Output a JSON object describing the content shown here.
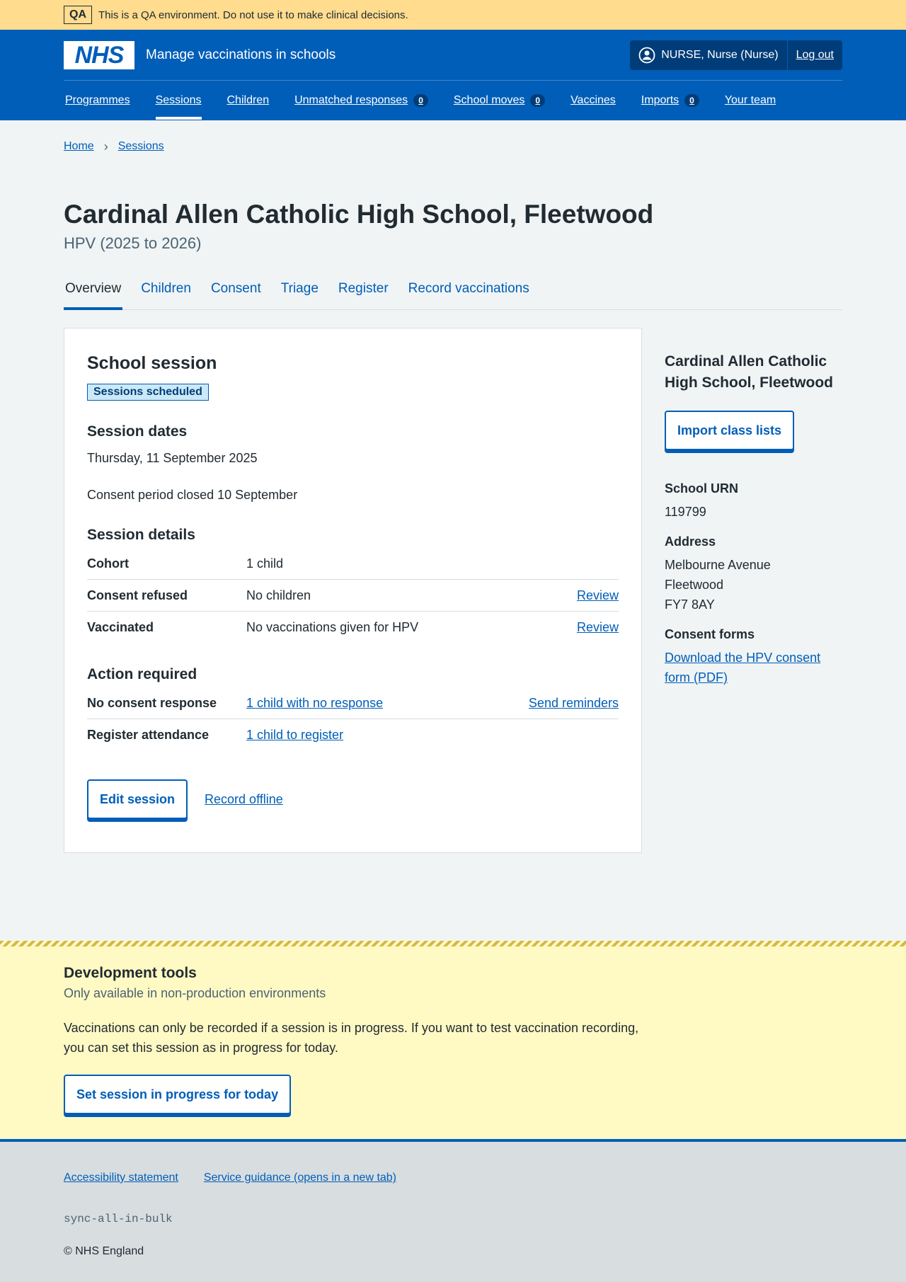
{
  "qa_banner": {
    "tag": "QA",
    "text": "This is a QA environment. Do not use it to make clinical decisions."
  },
  "header": {
    "logo_text": "NHS",
    "service_name": "Manage vaccinations in schools",
    "user_name": "NURSE, Nurse (Nurse)",
    "logout_label": "Log out"
  },
  "nav": {
    "items": [
      {
        "label": "Programmes"
      },
      {
        "label": "Sessions",
        "active": true
      },
      {
        "label": "Children"
      },
      {
        "label": "Unmatched responses",
        "count": "0"
      },
      {
        "label": "School moves",
        "count": "0"
      },
      {
        "label": "Vaccines"
      },
      {
        "label": "Imports",
        "count": "0"
      },
      {
        "label": "Your team"
      }
    ]
  },
  "breadcrumb": {
    "home": "Home",
    "sessions": "Sessions",
    "separator": "›"
  },
  "page": {
    "title": "Cardinal Allen Catholic High School, Fleetwood",
    "subtitle": "HPV (2025 to 2026)"
  },
  "tabs": [
    {
      "label": "Overview",
      "active": true
    },
    {
      "label": "Children"
    },
    {
      "label": "Consent"
    },
    {
      "label": "Triage"
    },
    {
      "label": "Register"
    },
    {
      "label": "Record vaccinations"
    }
  ],
  "card": {
    "heading": "School session",
    "status": "Sessions scheduled",
    "dates_heading": "Session dates",
    "date": "Thursday, 11 September 2025",
    "consent_period": "Consent period closed 10 September",
    "details_heading": "Session details",
    "details": [
      {
        "key": "Cohort",
        "value": "1 child",
        "action": ""
      },
      {
        "key": "Consent refused",
        "value": "No children",
        "action": "Review"
      },
      {
        "key": "Vaccinated",
        "value": "No vaccinations given for HPV",
        "action": "Review"
      }
    ],
    "action_heading": "Action required",
    "actions": [
      {
        "key": "No consent response",
        "value": "1 child with no response",
        "action": "Send reminders"
      },
      {
        "key": "Register attendance",
        "value": "1 child to register",
        "action": ""
      }
    ],
    "edit_button": "Edit session",
    "offline_link": "Record offline"
  },
  "sidebar": {
    "school_name": "Cardinal Allen Catholic High School, Fleetwood",
    "import_button": "Import class lists",
    "urn_label": "School URN",
    "urn_value": "119799",
    "address_label": "Address",
    "address_line1": "Melbourne Avenue",
    "address_line2": "Fleetwood",
    "address_line3": "FY7 8AY",
    "consent_forms_label": "Consent forms",
    "consent_forms_link": "Download the HPV consent form (PDF)"
  },
  "dev_tools": {
    "heading": "Development tools",
    "subheading": "Only available in non-production environments",
    "text": "Vaccinations can only be recorded if a session is in progress. If you want to test vaccination recording, you can set this session as in progress for today.",
    "button": "Set session in progress for today"
  },
  "footer": {
    "accessibility": "Accessibility statement",
    "guidance": "Service guidance (opens in a new tab)",
    "code": "sync-all-in-bulk",
    "copyright": "© NHS England"
  }
}
